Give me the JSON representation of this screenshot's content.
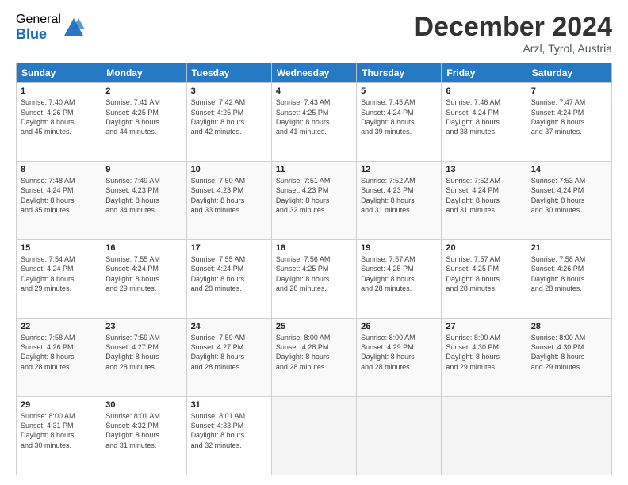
{
  "logo": {
    "general": "General",
    "blue": "Blue"
  },
  "header": {
    "month": "December 2024",
    "location": "Arzl, Tyrol, Austria"
  },
  "days_of_week": [
    "Sunday",
    "Monday",
    "Tuesday",
    "Wednesday",
    "Thursday",
    "Friday",
    "Saturday"
  ],
  "weeks": [
    [
      {
        "day": "1",
        "info": "Sunrise: 7:40 AM\nSunset: 4:26 PM\nDaylight: 8 hours\nand 45 minutes."
      },
      {
        "day": "2",
        "info": "Sunrise: 7:41 AM\nSunset: 4:25 PM\nDaylight: 8 hours\nand 44 minutes."
      },
      {
        "day": "3",
        "info": "Sunrise: 7:42 AM\nSunset: 4:25 PM\nDaylight: 8 hours\nand 42 minutes."
      },
      {
        "day": "4",
        "info": "Sunrise: 7:43 AM\nSunset: 4:25 PM\nDaylight: 8 hours\nand 41 minutes."
      },
      {
        "day": "5",
        "info": "Sunrise: 7:45 AM\nSunset: 4:24 PM\nDaylight: 8 hours\nand 39 minutes."
      },
      {
        "day": "6",
        "info": "Sunrise: 7:46 AM\nSunset: 4:24 PM\nDaylight: 8 hours\nand 38 minutes."
      },
      {
        "day": "7",
        "info": "Sunrise: 7:47 AM\nSunset: 4:24 PM\nDaylight: 8 hours\nand 37 minutes."
      }
    ],
    [
      {
        "day": "8",
        "info": "Sunrise: 7:48 AM\nSunset: 4:24 PM\nDaylight: 8 hours\nand 35 minutes."
      },
      {
        "day": "9",
        "info": "Sunrise: 7:49 AM\nSunset: 4:23 PM\nDaylight: 8 hours\nand 34 minutes."
      },
      {
        "day": "10",
        "info": "Sunrise: 7:50 AM\nSunset: 4:23 PM\nDaylight: 8 hours\nand 33 minutes."
      },
      {
        "day": "11",
        "info": "Sunrise: 7:51 AM\nSunset: 4:23 PM\nDaylight: 8 hours\nand 32 minutes."
      },
      {
        "day": "12",
        "info": "Sunrise: 7:52 AM\nSunset: 4:23 PM\nDaylight: 8 hours\nand 31 minutes."
      },
      {
        "day": "13",
        "info": "Sunrise: 7:52 AM\nSunset: 4:24 PM\nDaylight: 8 hours\nand 31 minutes."
      },
      {
        "day": "14",
        "info": "Sunrise: 7:53 AM\nSunset: 4:24 PM\nDaylight: 8 hours\nand 30 minutes."
      }
    ],
    [
      {
        "day": "15",
        "info": "Sunrise: 7:54 AM\nSunset: 4:24 PM\nDaylight: 8 hours\nand 29 minutes."
      },
      {
        "day": "16",
        "info": "Sunrise: 7:55 AM\nSunset: 4:24 PM\nDaylight: 8 hours\nand 29 minutes."
      },
      {
        "day": "17",
        "info": "Sunrise: 7:55 AM\nSunset: 4:24 PM\nDaylight: 8 hours\nand 28 minutes."
      },
      {
        "day": "18",
        "info": "Sunrise: 7:56 AM\nSunset: 4:25 PM\nDaylight: 8 hours\nand 28 minutes."
      },
      {
        "day": "19",
        "info": "Sunrise: 7:57 AM\nSunset: 4:25 PM\nDaylight: 8 hours\nand 28 minutes."
      },
      {
        "day": "20",
        "info": "Sunrise: 7:57 AM\nSunset: 4:25 PM\nDaylight: 8 hours\nand 28 minutes."
      },
      {
        "day": "21",
        "info": "Sunrise: 7:58 AM\nSunset: 4:26 PM\nDaylight: 8 hours\nand 28 minutes."
      }
    ],
    [
      {
        "day": "22",
        "info": "Sunrise: 7:58 AM\nSunset: 4:26 PM\nDaylight: 8 hours\nand 28 minutes."
      },
      {
        "day": "23",
        "info": "Sunrise: 7:59 AM\nSunset: 4:27 PM\nDaylight: 8 hours\nand 28 minutes."
      },
      {
        "day": "24",
        "info": "Sunrise: 7:59 AM\nSunset: 4:27 PM\nDaylight: 8 hours\nand 28 minutes."
      },
      {
        "day": "25",
        "info": "Sunrise: 8:00 AM\nSunset: 4:28 PM\nDaylight: 8 hours\nand 28 minutes."
      },
      {
        "day": "26",
        "info": "Sunrise: 8:00 AM\nSunset: 4:29 PM\nDaylight: 8 hours\nand 28 minutes."
      },
      {
        "day": "27",
        "info": "Sunrise: 8:00 AM\nSunset: 4:30 PM\nDaylight: 8 hours\nand 29 minutes."
      },
      {
        "day": "28",
        "info": "Sunrise: 8:00 AM\nSunset: 4:30 PM\nDaylight: 8 hours\nand 29 minutes."
      }
    ],
    [
      {
        "day": "29",
        "info": "Sunrise: 8:00 AM\nSunset: 4:31 PM\nDaylight: 8 hours\nand 30 minutes."
      },
      {
        "day": "30",
        "info": "Sunrise: 8:01 AM\nSunset: 4:32 PM\nDaylight: 8 hours\nand 31 minutes."
      },
      {
        "day": "31",
        "info": "Sunrise: 8:01 AM\nSunset: 4:33 PM\nDaylight: 8 hours\nand 32 minutes."
      },
      {
        "day": "",
        "info": ""
      },
      {
        "day": "",
        "info": ""
      },
      {
        "day": "",
        "info": ""
      },
      {
        "day": "",
        "info": ""
      }
    ]
  ]
}
